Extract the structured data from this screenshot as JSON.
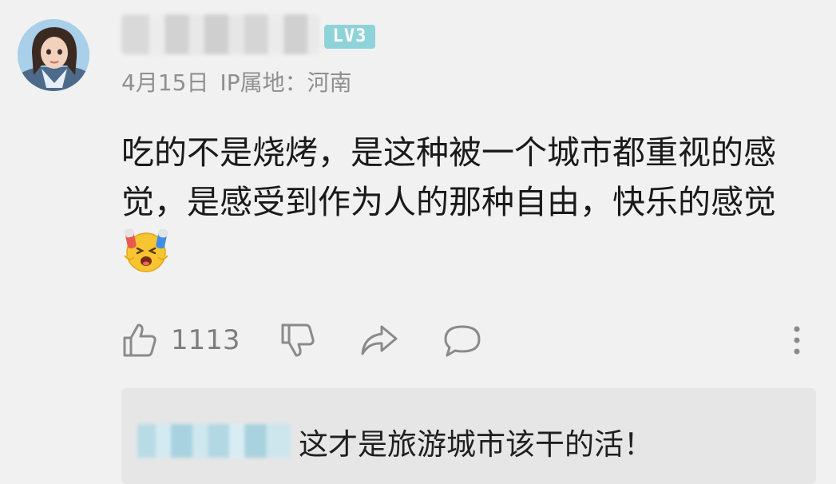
{
  "comment": {
    "level_badge": "LV3",
    "date": "4月15日",
    "ip_location": "IP属地：河南",
    "text": "吃的不是烧烤，是这种被一个城市都重视的感觉，是感受到作为人的那种自由，快乐的感觉",
    "emoji": "crying-laughing-face-icon",
    "like_count": "1113"
  },
  "reply": {
    "text": "这才是旅游城市该干的活！"
  },
  "colors": {
    "background": "#f1f1f1",
    "level_badge": "#8fd3da",
    "meta_text": "#8f8f8f",
    "reply_background": "#e6e6e6"
  }
}
